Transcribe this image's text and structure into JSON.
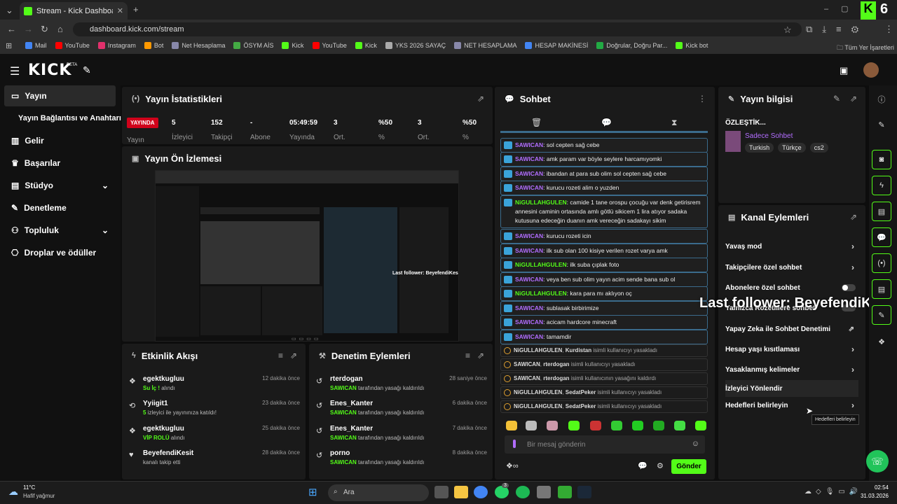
{
  "browser": {
    "tab_title": "Stream - Kick Dashboard",
    "url": "dashboard.kick.com/stream",
    "bookmarks": [
      "Mail",
      "YouTube",
      "Instagram",
      "Bot",
      "Net Hesaplama",
      "ÖSYM AİS",
      "Kick",
      "YouTube",
      "Kick",
      "YKS 2026 SAYAÇ",
      "NET HESAPLAMA",
      "HESAP MAKİNESİ",
      "Doğrular, Doğru Par...",
      "Kick bot"
    ],
    "all_bookmarks": "Tüm Yer İşaretleri"
  },
  "app": {
    "logo": "KICK",
    "logo_beta": "BETA",
    "overlay_count": "6"
  },
  "sidebar": {
    "items": [
      {
        "label": "Yayın"
      },
      {
        "label": "Yayın Bağlantısı ve Anahtarı"
      },
      {
        "label": "Gelir"
      },
      {
        "label": "Başarılar"
      },
      {
        "label": "Stüdyo"
      },
      {
        "label": "Denetleme"
      },
      {
        "label": "Topluluk"
      },
      {
        "label": "Droplar ve ödüller"
      }
    ]
  },
  "stats": {
    "title": "Yayın İstatistikleri",
    "live_badge": "YAYINDA",
    "status_label": "Yayın",
    "items": [
      {
        "value": "5",
        "label": "İzleyici"
      },
      {
        "value": "152",
        "label": "Takipçi"
      },
      {
        "value": "-",
        "label": "Abone"
      },
      {
        "value": "05:49:59",
        "label": "Yayında"
      },
      {
        "value": "3",
        "label": "Ort."
      },
      {
        "value": "%50",
        "label": "%"
      },
      {
        "value": "3",
        "label": "Ort."
      },
      {
        "value": "%50",
        "label": "%"
      }
    ]
  },
  "preview": {
    "title": "Yayın Ön İzlemesi",
    "overlay_text": "Last follower: BeyefendiKes"
  },
  "activity": {
    "title": "Etkinlik Akışı",
    "items": [
      {
        "name": "egektkugluu",
        "detail": "Su İç !",
        "suffix": "alındı",
        "time": "12 dakika önce"
      },
      {
        "name": "Yyiigit1",
        "detail": "5",
        "suffix": "izleyici ile yayınınıza katıldı!",
        "time": "23 dakika önce"
      },
      {
        "name": "egektkugluu",
        "detail": "VİP ROLÜ",
        "suffix": "alındı",
        "time": "25 dakika önce"
      },
      {
        "name": "BeyefendiKesit",
        "detail": "",
        "suffix": "kanalı takip etti",
        "time": "28 dakika önce"
      }
    ]
  },
  "moderation": {
    "title": "Denetim Eylemleri",
    "items": [
      {
        "name": "rterdogan",
        "by": "SAWICAN",
        "suffix": "tarafından yasağı kaldırıldı",
        "time": "28 saniye önce"
      },
      {
        "name": "Enes_Kanter",
        "by": "SAWICAN",
        "suffix": "tarafından yasağı kaldırıldı",
        "time": "6 dakika önce"
      },
      {
        "name": "Enes_Kanter",
        "by": "SAWICAN",
        "suffix": "tarafından yasağı kaldırıldı",
        "time": "7 dakika önce"
      },
      {
        "name": "porno",
        "by": "SAWICAN",
        "suffix": "tarafından yasağı kaldırıldı",
        "time": "8 dakika önce"
      }
    ]
  },
  "chat": {
    "title": "Sohbet",
    "messages": [
      {
        "user": "SAWICAN",
        "text": "sol cepten sağ cebe"
      },
      {
        "user": "SAWICAN",
        "text": "amk param var böyle seylere harcamıyomki"
      },
      {
        "user": "SAWICAN",
        "text": "ibandan at para sub olim sol cepten sağ cebe"
      },
      {
        "user": "SAWICAN",
        "text": "kurucu rozeti alim o yuzden"
      },
      {
        "user": "NiGULLAHGULEN",
        "text": "camide 1 tane orospu çocuğu var denk getirisrem annesini caminin ortasında amlı götlü sikicem 1 lira atıyor sadaka kutusuna edeceğin duanın amk vereceğin sadakayı sikim"
      },
      {
        "user": "SAWICAN",
        "text": "kurucu rozeti icin"
      },
      {
        "user": "SAWICAN",
        "text": "ilk sub olan 100 kisiye verilen rozet varya amk"
      },
      {
        "user": "NiGULLAHGULEN",
        "text": "ilk suba çıplak foto"
      },
      {
        "user": "SAWICAN",
        "text": "veya ben sub olim yayın acim sende bana sub ol"
      },
      {
        "user": "NiGULLAHGULEN",
        "text": "kara para mı aklıyon oç"
      },
      {
        "user": "SAWICAN",
        "text": "sublasak birbirimize"
      },
      {
        "user": "SAWICAN",
        "text": "acicam hardcore minecraft"
      },
      {
        "user": "SAWICAN",
        "text": "tamamdir"
      }
    ],
    "mod_events": [
      {
        "actor": "NiGULLAHGULEN",
        "target": "Kurdistan",
        "text": "isimli kullanıcıyı yasakladı"
      },
      {
        "actor": "SAWICAN",
        "target": "rterdogan",
        "text": "isimli kullanıcıyı yasakladı"
      },
      {
        "actor": "SAWICAN",
        "target": "rterdogan",
        "text": "isimli kullanıcının yasağını kaldırdı"
      },
      {
        "actor": "NiGULLAHGULEN",
        "target": "SedatPeker",
        "text": "isimli kullanıcıyı yasakladı"
      },
      {
        "actor": "NiGULLAHGULEN",
        "target": "SedatPeker",
        "text": "isimli kullanıcıyı yasakladı"
      }
    ],
    "placeholder": "Bir mesaj gönderin",
    "send_label": "Gönder"
  },
  "info": {
    "title": "Yayın bilgisi",
    "stream_title": "ÖZLEŞTİK...",
    "category": "Sadece Sohbet",
    "tags": [
      "Turkish",
      "Türkçe",
      "cs2"
    ]
  },
  "channel": {
    "title": "Kanal Eylemleri",
    "rows": [
      {
        "label": "Yavaş mod",
        "kind": "chevron"
      },
      {
        "label": "Takipçilere özel sohbet",
        "kind": "chevron"
      },
      {
        "label": "Abonelere özel sohbet",
        "kind": "toggle"
      },
      {
        "label": "Yalnızca Rozetlilere sohbet",
        "kind": "toggle"
      },
      {
        "label": "Yapay Zeka ile Sohbet Denetimi",
        "kind": "external"
      },
      {
        "label": "Hesap yaşı kısıtlaması",
        "kind": "chevron"
      },
      {
        "label": "Yasaklanmış kelimeler",
        "kind": "chevron"
      },
      {
        "label": "İzleyici Yönlendir",
        "kind": "none"
      },
      {
        "label": "Hedefleri belirleyin",
        "kind": "chevron"
      }
    ],
    "tooltip": "Hedefleri belirleyin"
  },
  "taskbar": {
    "temp": "11°C",
    "weather": "Hafif yağmur",
    "search": "Ara",
    "time": "02:54",
    "date": "31.03.2026",
    "badge": "3"
  }
}
